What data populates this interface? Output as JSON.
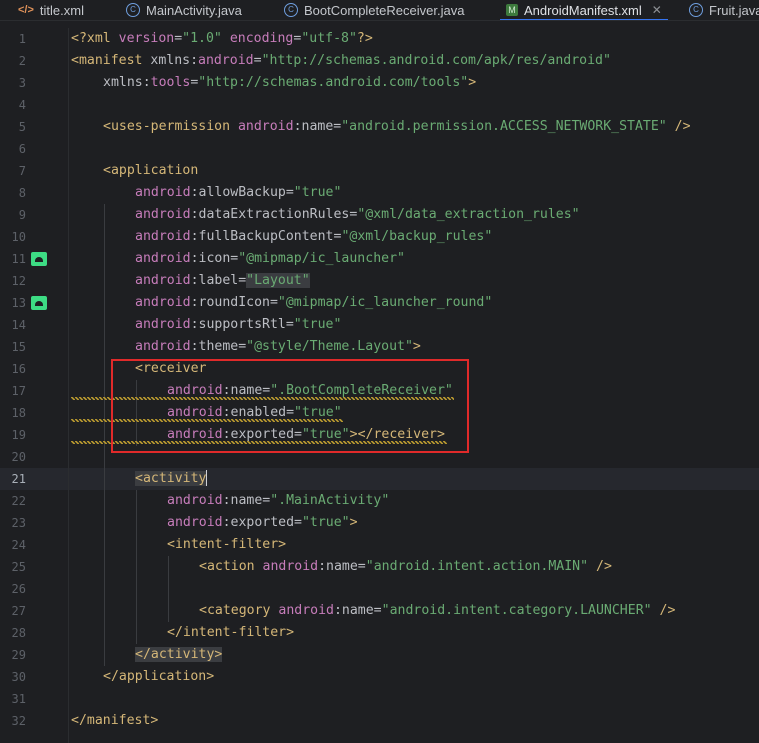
{
  "tabs": [
    {
      "label": "title.xml",
      "icon": "xml-code-icon",
      "active": false
    },
    {
      "label": "MainActivity.java",
      "icon": "java-class-icon",
      "active": false
    },
    {
      "label": "BootCompleteReceiver.java",
      "icon": "java-class-icon",
      "active": false
    },
    {
      "label": "AndroidManifest.xml",
      "icon": "manifest-icon",
      "active": true,
      "close_glyph": "✕"
    },
    {
      "label": "Fruit.java",
      "icon": "java-class-icon",
      "active": false
    }
  ],
  "editor": {
    "current_line": 21,
    "line_numbers": [
      "1",
      "2",
      "3",
      "4",
      "5",
      "6",
      "7",
      "8",
      "9",
      "10",
      "11",
      "12",
      "13",
      "14",
      "15",
      "16",
      "17",
      "18",
      "19",
      "20",
      "21",
      "22",
      "23",
      "24",
      "25",
      "26",
      "27",
      "28",
      "29",
      "30",
      "31",
      "32"
    ],
    "gutter_markers": [
      {
        "line": 11,
        "icon": "android-icon"
      },
      {
        "line": 13,
        "icon": "android-icon"
      }
    ],
    "highlight": {
      "lines": [
        16,
        19
      ],
      "color": "#e02a2a"
    },
    "lines": {
      "l1": {
        "p1": "<?xml ",
        "a1": "version",
        "p2": "=",
        "s1": "\"1.0\"",
        "p3": " ",
        "a2": "encoding",
        "p4": "=",
        "s2": "\"utf-8\"",
        "p5": "?>"
      },
      "l2": {
        "t1": "<manifest ",
        "a1": "xmlns:",
        "a2": "android",
        "p1": "=",
        "s1": "\"http://schemas.android.com/apk/res/android\""
      },
      "l3": {
        "a1": "xmlns:",
        "a2": "tools",
        "p1": "=",
        "s1": "\"http://schemas.android.com/tools\"",
        "t1": ">"
      },
      "l5": {
        "t1": "<uses-permission ",
        "a1": "android",
        "p1": ":name=",
        "s1": "\"android.permission.ACCESS_NETWORK_STATE\"",
        "t2": " />"
      },
      "l7": {
        "t1": "<application"
      },
      "l8": {
        "a1": "android",
        "p1": ":allowBackup=",
        "s1": "\"true\""
      },
      "l9": {
        "a1": "android",
        "p1": ":dataExtractionRules=",
        "s1": "\"@xml/data_extraction_rules\""
      },
      "l10": {
        "a1": "android",
        "p1": ":fullBackupContent=",
        "s1": "\"@xml/backup_rules\""
      },
      "l11": {
        "a1": "android",
        "p1": ":icon=",
        "s1": "\"@mipmap/ic_launcher\""
      },
      "l12": {
        "a1": "android",
        "p1": ":label=",
        "s1": "\"Layout\""
      },
      "l13": {
        "a1": "android",
        "p1": ":roundIcon=",
        "s1": "\"@mipmap/ic_launcher_round\""
      },
      "l14": {
        "a1": "android",
        "p1": ":supportsRtl=",
        "s1": "\"true\""
      },
      "l15": {
        "a1": "android",
        "p1": ":theme=",
        "s1": "\"@style/Theme.Layout\"",
        "t1": ">"
      },
      "l16": {
        "t1": "<receiver"
      },
      "l17": {
        "a1": "android",
        "p1": ":name=",
        "s1": "\".BootCompleteReceiver\""
      },
      "l18": {
        "a1": "android",
        "p1": ":enabled=",
        "s1": "\"true\""
      },
      "l19": {
        "a1": "android",
        "p1": ":exported=",
        "s1": "\"true\"",
        "t1": "></receiver>"
      },
      "l21": {
        "t1": "<activity"
      },
      "l22": {
        "a1": "android",
        "p1": ":name=",
        "s1": "\".MainActivity\""
      },
      "l23": {
        "a1": "android",
        "p1": ":exported=",
        "s1": "\"true\"",
        "t1": ">"
      },
      "l24": {
        "t1": "<intent-filter>"
      },
      "l25": {
        "t1": "<action ",
        "a1": "android",
        "p1": ":name=",
        "s1": "\"android.intent.action.MAIN\"",
        "t2": " />"
      },
      "l27": {
        "t1": "<category ",
        "a1": "android",
        "p1": ":name=",
        "s1": "\"android.intent.category.LAUNCHER\"",
        "t2": " />"
      },
      "l28": {
        "t1": "</intent-filter>"
      },
      "l29": {
        "t1": "</activity>"
      },
      "l30": {
        "t1": "</application>"
      },
      "l32": {
        "t1": "</manifest>"
      }
    }
  }
}
